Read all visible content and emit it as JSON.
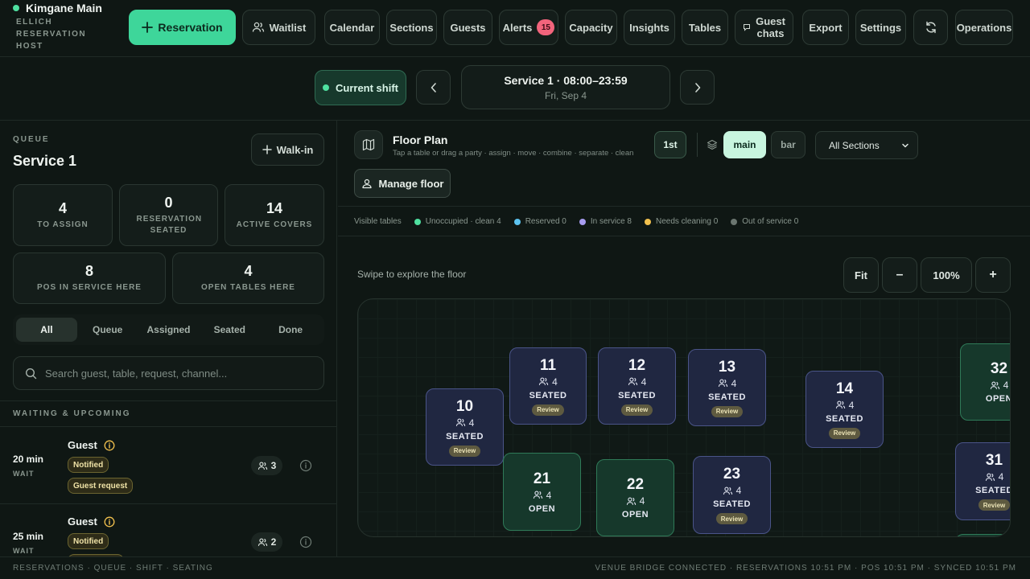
{
  "brand": {
    "title": "Kimgane Main",
    "subtitle": "ELLICH RESERVATION HOST"
  },
  "nav": {
    "reservation": "Reservation",
    "waitlist": "Waitlist",
    "calendar": "Calendar",
    "sections": "Sections",
    "guests": "Guests",
    "alerts": "Alerts",
    "alerts_count": "15",
    "capacity": "Capacity",
    "insights": "Insights",
    "tables": "Tables",
    "guest_chats": "Guest chats",
    "export": "Export",
    "settings": "Settings",
    "operations": "Operations"
  },
  "shift": {
    "current_label": "Current shift",
    "service_title": "Service 1 · 08:00–23:59",
    "service_date": "Fri, Sep 4"
  },
  "queue": {
    "label": "QUEUE",
    "title": "Service 1",
    "walkin": "Walk-in",
    "stats": [
      {
        "value": "4",
        "label": "TO ASSIGN"
      },
      {
        "value": "0",
        "label": "RESERVATION SEATED"
      },
      {
        "value": "14",
        "label": "ACTIVE COVERS"
      },
      {
        "value": "8",
        "label": "POS IN SERVICE HERE"
      },
      {
        "value": "4",
        "label": "OPEN TABLES HERE"
      }
    ],
    "filters": [
      "All",
      "Queue",
      "Assigned",
      "Seated",
      "Done"
    ],
    "search_placeholder": "Search guest, table, request, channel...",
    "section_label": "WAITING & UPCOMING",
    "items": [
      {
        "wait": "20 min",
        "wait_label": "WAIT",
        "name": "Guest",
        "tag1": "Notified",
        "tag2": "Guest request",
        "party": "3"
      },
      {
        "wait": "25 min",
        "wait_label": "WAIT",
        "name": "Guest",
        "tag1": "Notified",
        "party": "2"
      }
    ]
  },
  "floor": {
    "title": "Floor Plan",
    "subtitle": "Tap a table or drag a party · assign · move · combine · separate · clean",
    "floor_level": "1st",
    "area_main": "main",
    "area_bar": "bar",
    "section_select": "All Sections",
    "manage": "Manage floor",
    "legend_title": "Visible tables",
    "legend": [
      {
        "label": "Unoccupied · clean 4",
        "color": "#4fe0a0"
      },
      {
        "label": "Reserved 0",
        "color": "#5cc3f0"
      },
      {
        "label": "In service 8",
        "color": "#a79cf0"
      },
      {
        "label": "Needs cleaning 0",
        "color": "#f2c14e"
      },
      {
        "label": "Out of service 0",
        "color": "#6b7670"
      }
    ],
    "swipe_hint": "Swipe to explore the floor",
    "zoom_fit": "Fit",
    "zoom_out": "–",
    "zoom_level": "100%",
    "zoom_in": "+",
    "review_label": "Review",
    "tables": [
      {
        "num": "10",
        "cap": "4",
        "status": "SEATED",
        "state": "seated"
      },
      {
        "num": "11",
        "cap": "4",
        "status": "SEATED",
        "state": "seated"
      },
      {
        "num": "12",
        "cap": "4",
        "status": "SEATED",
        "state": "seated"
      },
      {
        "num": "13",
        "cap": "4",
        "status": "SEATED",
        "state": "seated"
      },
      {
        "num": "14",
        "cap": "4",
        "status": "SEATED",
        "state": "seated"
      },
      {
        "num": "32",
        "cap": "4",
        "status": "OPEN",
        "state": "open"
      },
      {
        "num": "21",
        "cap": "4",
        "status": "OPEN",
        "state": "open"
      },
      {
        "num": "22",
        "cap": "4",
        "status": "OPEN",
        "state": "open"
      },
      {
        "num": "23",
        "cap": "4",
        "status": "SEATED",
        "state": "seated"
      },
      {
        "num": "31",
        "cap": "4",
        "status": "SEATED",
        "state": "seated"
      }
    ]
  },
  "footer": {
    "left": "RESERVATIONS · QUEUE · SHIFT · SEATING",
    "right": "VENUE BRIDGE CONNECTED · RESERVATIONS 10:51 PM · POS 10:51 PM · SYNCED 10:51 PM"
  },
  "colors": {
    "accent": "#3ed69a",
    "alert": "#f2647c",
    "seated": "#4a5488",
    "open": "#2f7a58"
  }
}
